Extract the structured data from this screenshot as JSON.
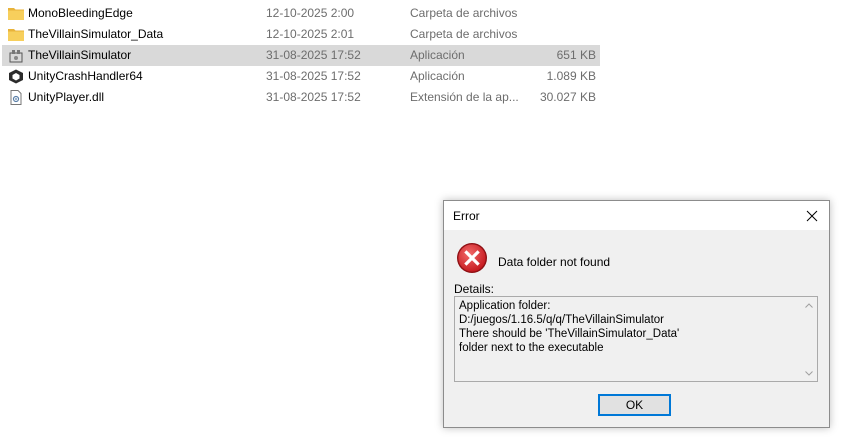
{
  "files": [
    {
      "name": "MonoBleedingEdge",
      "date": "12-10-2025 2:00",
      "type": "Carpeta de archivos",
      "size": "",
      "icon": "folder-icon"
    },
    {
      "name": "TheVillainSimulator_Data",
      "date": "12-10-2025 2:01",
      "type": "Carpeta de archivos",
      "size": "",
      "icon": "folder-icon"
    },
    {
      "name": "TheVillainSimulator",
      "date": "31-08-2025 17:52",
      "type": "Aplicación",
      "size": "651 KB",
      "icon": "app-icon"
    },
    {
      "name": "UnityCrashHandler64",
      "date": "31-08-2025 17:52",
      "type": "Aplicación",
      "size": "1.089 KB",
      "icon": "unity-icon"
    },
    {
      "name": "UnityPlayer.dll",
      "date": "31-08-2025 17:52",
      "type": "Extensión de la ap...",
      "size": "30.027 KB",
      "icon": "dll-icon"
    }
  ],
  "dialog": {
    "title": "Error",
    "message": "Data folder not found",
    "details_label": "Details:",
    "details_text": "Application folder:\nD:/juegos/1.16.5/q/q/TheVillainSimulator\nThere should be 'TheVillainSimulator_Data'\nfolder next to the executable",
    "ok_label": "OK"
  },
  "colors": {
    "selection": "#d9d9d9",
    "folder": "#f4c54b",
    "error_red": "#d9262b",
    "button_border": "#0078d7"
  }
}
